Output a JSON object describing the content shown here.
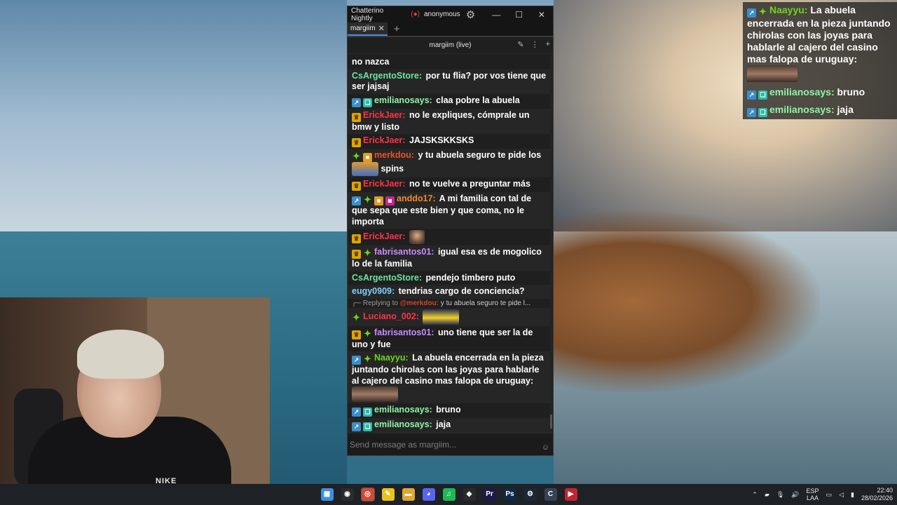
{
  "chat_window": {
    "app_title": "Chatterino Nightly",
    "user": "anonymous",
    "tab_label": "margiim",
    "channel_header": "margiim (live)",
    "input_placeholder": "Send message as margiim...",
    "messages": [
      {
        "nick": "",
        "nick_color": "#ffffff",
        "badges": [],
        "text": "no nazca"
      },
      {
        "nick": "CsArgentoStore:",
        "nick_color": "#6fe3a3",
        "badges": [],
        "text": "por tu flia? por vos tiene que ser jajsaj"
      },
      {
        "nick": "emilianosays:",
        "nick_color": "#8ef4a6",
        "badges": [
          "arrow",
          "gift"
        ],
        "text": "claa pobre la abuela"
      },
      {
        "nick": "ErickJaer:",
        "nick_color": "#ff3347",
        "badges": [
          "crown"
        ],
        "text": "no le expliques, cómprale un bmw y listo"
      },
      {
        "nick": "ErickJaer:",
        "nick_color": "#ff3347",
        "badges": [
          "crown"
        ],
        "text": "JAJSKSKKSKS"
      },
      {
        "nick": "merkdou:",
        "nick_color": "#e8512f",
        "badges": [
          "diamond",
          "box"
        ],
        "text": "y tu abuela seguro te pide los",
        "emote": "sky",
        "after": "spins"
      },
      {
        "nick": "ErickJaer:",
        "nick_color": "#ff3347",
        "badges": [
          "crown"
        ],
        "text": "no te vuelve a preguntar más"
      },
      {
        "nick": "anddo17:",
        "nick_color": "#f08b2e",
        "badges": [
          "arrow",
          "diamond",
          "box",
          "pink"
        ],
        "text": "A mi familia con tal de que sepa que este bien y que coma, no le importa"
      },
      {
        "nick": "ErickJaer:",
        "nick_color": "#ff3347",
        "badges": [
          "crown"
        ],
        "text": "",
        "emote": "face"
      },
      {
        "nick": "fabrisantos01:",
        "nick_color": "#c98cff",
        "badges": [
          "crown",
          "diamond"
        ],
        "text": "igual esa es de mogolico lo de la familia"
      },
      {
        "nick": "CsArgentoStore:",
        "nick_color": "#6fe3a3",
        "badges": [],
        "text": "pendejo timbero puto"
      },
      {
        "nick": "eugy0909:",
        "nick_color": "#7fd0ff",
        "badges": [],
        "text": "tendrias cargo de conciencia?"
      },
      {
        "reply": true,
        "reply_prefix": "Replying to",
        "reply_mention": "@merkdou:",
        "reply_text": "y tu abuela seguro te pide l..."
      },
      {
        "nick": "Luciano_002:",
        "nick_color": "#ff3347",
        "badges": [
          "diamond"
        ],
        "text": "",
        "emote": "yellow"
      },
      {
        "nick": "fabrisantos01:",
        "nick_color": "#c98cff",
        "badges": [
          "crown",
          "diamond"
        ],
        "text": "uno tiene que ser la de uno y fue"
      },
      {
        "nick": "Naayyu:",
        "nick_color": "#6cd61b",
        "badges": [
          "arrow",
          "diamond"
        ],
        "text": "La abuela encerrada en la pieza juntando chirolas con las joyas para hablarle al cajero del casino mas falopa de uruguay:",
        "emote": "wide"
      },
      {
        "nick": "emilianosays:",
        "nick_color": "#8ef4a6",
        "badges": [
          "arrow",
          "gift"
        ],
        "text": "bruno"
      },
      {
        "nick": "emilianosays:",
        "nick_color": "#8ef4a6",
        "badges": [
          "arrow",
          "gift"
        ],
        "text": "jaja"
      }
    ]
  },
  "overlay": {
    "messages": [
      {
        "nick": "Naayyu:",
        "nick_color": "#6cd61b",
        "text": "La abuela encerrada en la pieza juntando chirolas con las joyas para hablarle al cajero del casino mas falopa de uruguay:",
        "emote": true
      },
      {
        "nick": "emilianosays:",
        "nick_color": "#8ef4a6",
        "text": "bruno"
      },
      {
        "nick": "emilianosays:",
        "nick_color": "#8ef4a6",
        "text": "jaja"
      }
    ]
  },
  "webcam": {
    "shirt_logo": "NIKE"
  },
  "taskbar": {
    "apps": [
      {
        "name": "windows-start-icon",
        "glyph": "▦",
        "color": "#3d8ee0"
      },
      {
        "name": "obs-icon",
        "glyph": "◉",
        "color": "#2b2b2b"
      },
      {
        "name": "chrome-icon",
        "glyph": "◎",
        "color": "#d04a35"
      },
      {
        "name": "notes-icon",
        "glyph": "✎",
        "color": "#e9c31b"
      },
      {
        "name": "folder-icon",
        "glyph": "▬",
        "color": "#e0a832"
      },
      {
        "name": "discord-icon",
        "glyph": "◕",
        "color": "#5865f2"
      },
      {
        "name": "spotify-icon",
        "glyph": "♫",
        "color": "#1db954"
      },
      {
        "name": "epic-icon",
        "glyph": "◆",
        "color": "#2a2a2a"
      },
      {
        "name": "premiere-icon",
        "glyph": "Pr",
        "color": "#1d1a4a"
      },
      {
        "name": "photoshop-icon",
        "glyph": "Ps",
        "color": "#0d2a47"
      },
      {
        "name": "steam-icon",
        "glyph": "⚙",
        "color": "#1b2838"
      },
      {
        "name": "chatterino-icon",
        "glyph": "C",
        "color": "#334455"
      },
      {
        "name": "video-editor-icon",
        "glyph": "▶",
        "color": "#c0262d"
      }
    ],
    "language_top": "ESP",
    "language_bottom": "LAA",
    "time": "22:40",
    "date": "28/02/2026"
  }
}
